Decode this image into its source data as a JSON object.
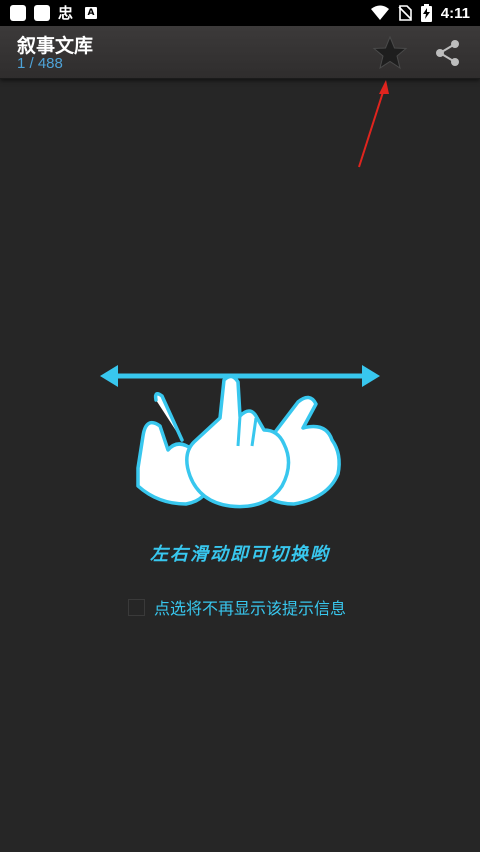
{
  "status_bar": {
    "time": "4:11",
    "left_glyph": "忠",
    "a_badge": "A",
    "icons": [
      "app-square-icon",
      "app-square-icon",
      "app-glyph-icon",
      "a-badge-icon",
      "wifi-icon",
      "no-sim-icon",
      "battery-charging-icon"
    ]
  },
  "toolbar": {
    "title": "叙事文库",
    "counter": "1 / 488",
    "star_icon": "star-icon",
    "share_icon": "share-icon"
  },
  "main": {
    "gesture_icon": "swipe-hands-icon",
    "hint_text": "左右滑动即可切换哟",
    "checkbox_label": "点选将不再显示该提示信息",
    "checkbox_checked": false
  },
  "colors": {
    "background": "#262626",
    "accent": "#38c7ee",
    "counter": "#4ea3d8",
    "annotation": "#e0241e"
  }
}
